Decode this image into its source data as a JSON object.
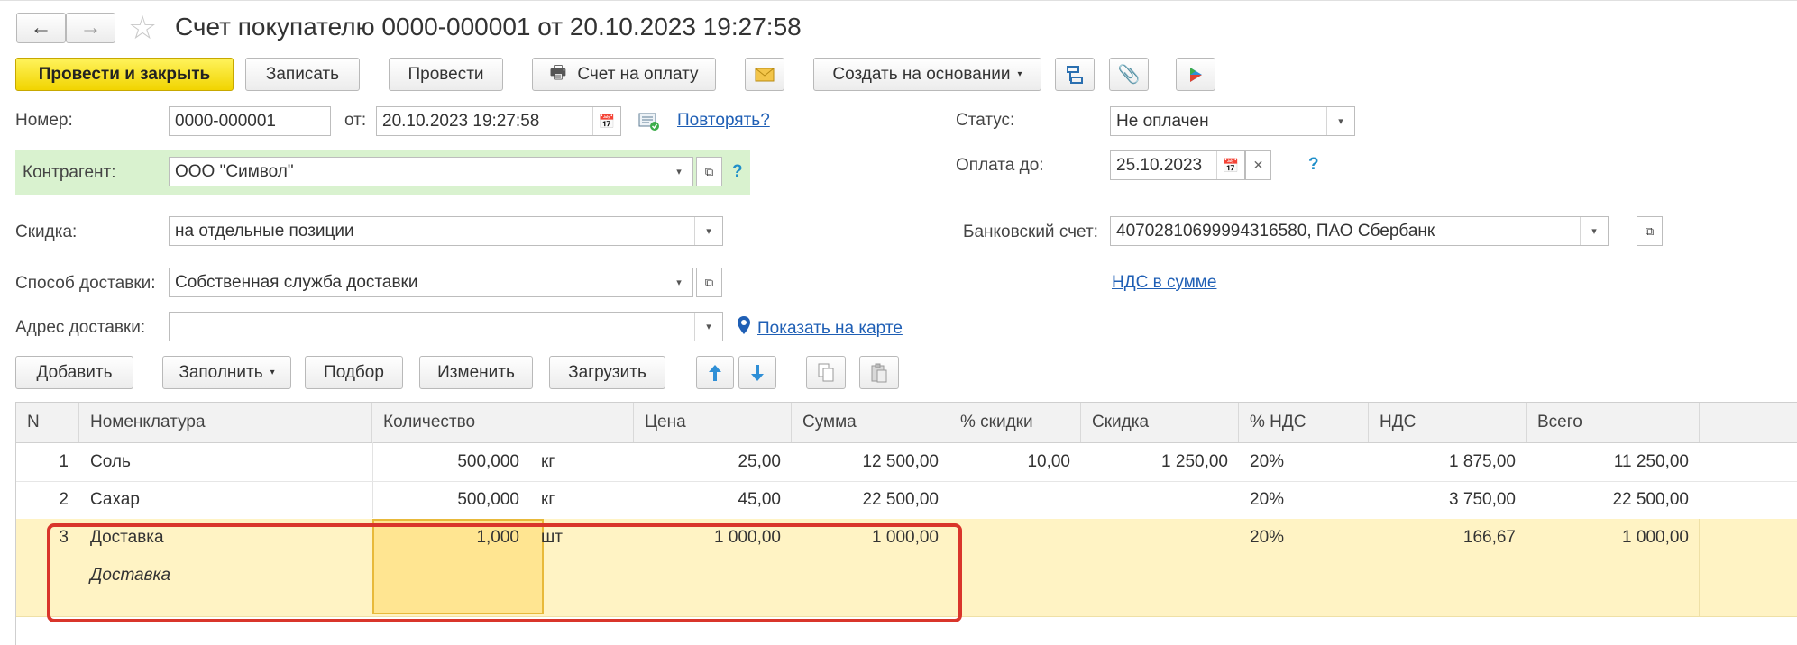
{
  "window": {
    "title": "Счет покупателю 0000-000001 от 20.10.2023 19:27:58"
  },
  "toolbar": {
    "post_close": "Провести и закрыть",
    "save": "Записать",
    "post": "Провести",
    "invoice": "Счет на оплату",
    "create_based": "Создать на основании"
  },
  "form": {
    "number_label": "Номер:",
    "number": "0000-000001",
    "from_label": "от:",
    "date": "20.10.2023 19:27:58",
    "repeat_link": "Повторять?",
    "status_label": "Статус:",
    "status": "Не оплачен",
    "pay_until_label": "Оплата до:",
    "pay_until": "25.10.2023",
    "contractor_label": "Контрагент:",
    "contractor": "ООО \"Символ\"",
    "discount_label": "Скидка:",
    "discount": "на отдельные позиции",
    "bank_label": "Банковский счет:",
    "bank": "40702810699994316580, ПАО Сбербанк",
    "vat_link": "НДС в сумме",
    "delivery_method_label": "Способ доставки:",
    "delivery_method": "Собственная служба доставки",
    "delivery_address_label": "Адрес доставки:",
    "delivery_address": "",
    "show_map": "Показать на карте",
    "help": "?"
  },
  "tablebar": {
    "add": "Добавить",
    "fill": "Заполнить",
    "pick": "Подбор",
    "change": "Изменить",
    "load": "Загрузить"
  },
  "table": {
    "headers": [
      "N",
      "Номенклатура",
      "Количество",
      "Цена",
      "Сумма",
      "% скидки",
      "Скидка",
      "% НДС",
      "НДС",
      "Всего"
    ],
    "rows": [
      {
        "n": "1",
        "name": "Соль",
        "qty": "500,000",
        "unit": "кг",
        "price": "25,00",
        "sum": "12 500,00",
        "disc_pct": "10,00",
        "disc": "1 250,00",
        "vat_pct": "20%",
        "vat": "1 875,00",
        "total": "11 250,00",
        "content": ""
      },
      {
        "n": "2",
        "name": "Сахар",
        "qty": "500,000",
        "unit": "кг",
        "price": "45,00",
        "sum": "22 500,00",
        "disc_pct": "",
        "disc": "",
        "vat_pct": "20%",
        "vat": "3 750,00",
        "total": "22 500,00",
        "content": ""
      },
      {
        "n": "3",
        "name": "Доставка",
        "qty": "1,000",
        "unit": "шт",
        "price": "1 000,00",
        "sum": "1 000,00",
        "disc_pct": "",
        "disc": "",
        "vat_pct": "20%",
        "vat": "166,67",
        "total": "1 000,00",
        "content": "Доставка"
      }
    ]
  },
  "colors": {
    "primary": "#f5d90a",
    "highlight_row": "#fff3c4",
    "highlight_cell": "#ffe591",
    "annotation": "#d9352b",
    "contractor_bg": "#d9f2cf",
    "link": "#1f5fb5"
  }
}
